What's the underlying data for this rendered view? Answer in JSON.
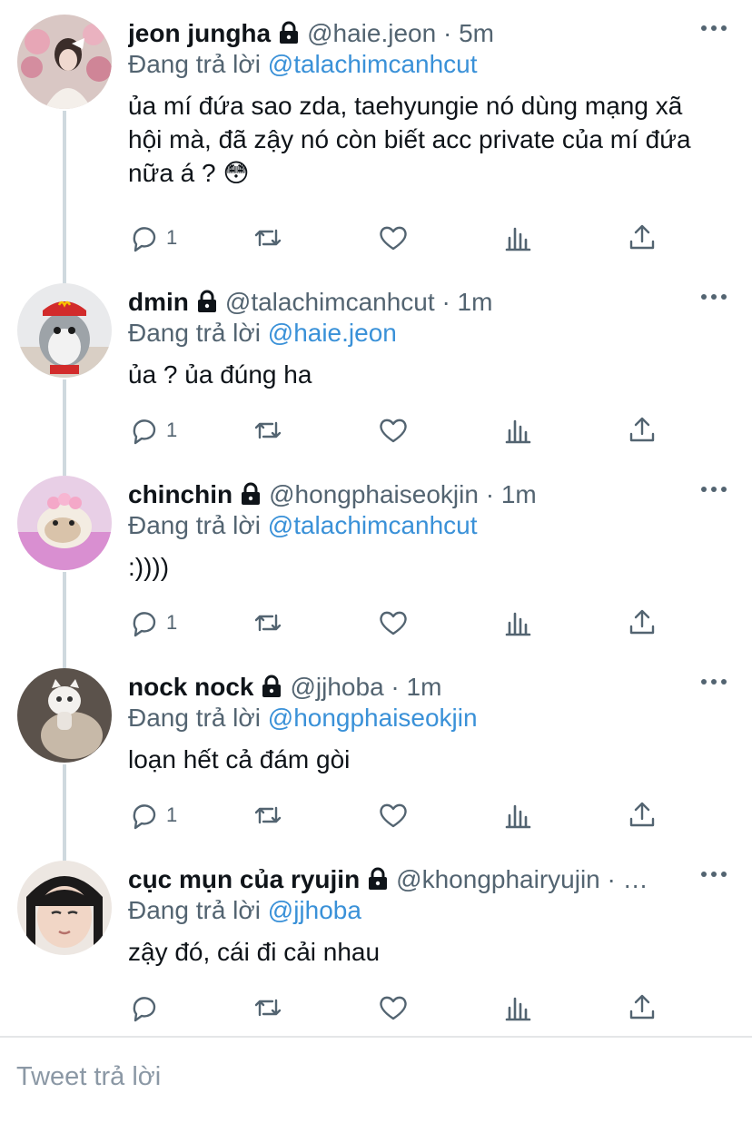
{
  "replying_prefix": "Đang trả lời",
  "compose_placeholder": "Tweet trả lời",
  "colors": {
    "mention": "#3a91d8",
    "secondary": "#536471",
    "thread_line": "#cfd9de"
  },
  "tweets": [
    {
      "name": "jeon jungha",
      "handle": "@haie.jeon",
      "dot": "·",
      "time": "5m",
      "replying_to": "@talachimcanhcut",
      "text": "ủa mí đứa sao zda, taehyungie nó dùng mạng xã hội mà, đã zậy nó còn biết acc private của mí đứa nữa á ? 😳",
      "reply_count": "1"
    },
    {
      "name": "dmin",
      "handle": "@talachimcanhcut",
      "dot": "·",
      "time": "1m",
      "replying_to": "@haie.jeon",
      "text": "ủa ? ủa đúng ha",
      "reply_count": "1"
    },
    {
      "name": "chinchin",
      "handle": "@hongphaiseokjin",
      "dot": "·",
      "time": "1m",
      "replying_to": "@talachimcanhcut",
      "text": ":))))",
      "reply_count": "1"
    },
    {
      "name": "nock nock",
      "handle": "@jjhoba",
      "dot": "·",
      "time": "1m",
      "replying_to": "@hongphaiseokjin",
      "text": "loạn hết cả đám gòi",
      "reply_count": "1"
    },
    {
      "name": "cục mụn của ryujin",
      "handle": "@khongphairyujin",
      "dot": "·",
      "time": "…",
      "replying_to": "@jjhoba",
      "text": "zậy đó, cái đi cải nhau",
      "reply_count": ""
    }
  ]
}
